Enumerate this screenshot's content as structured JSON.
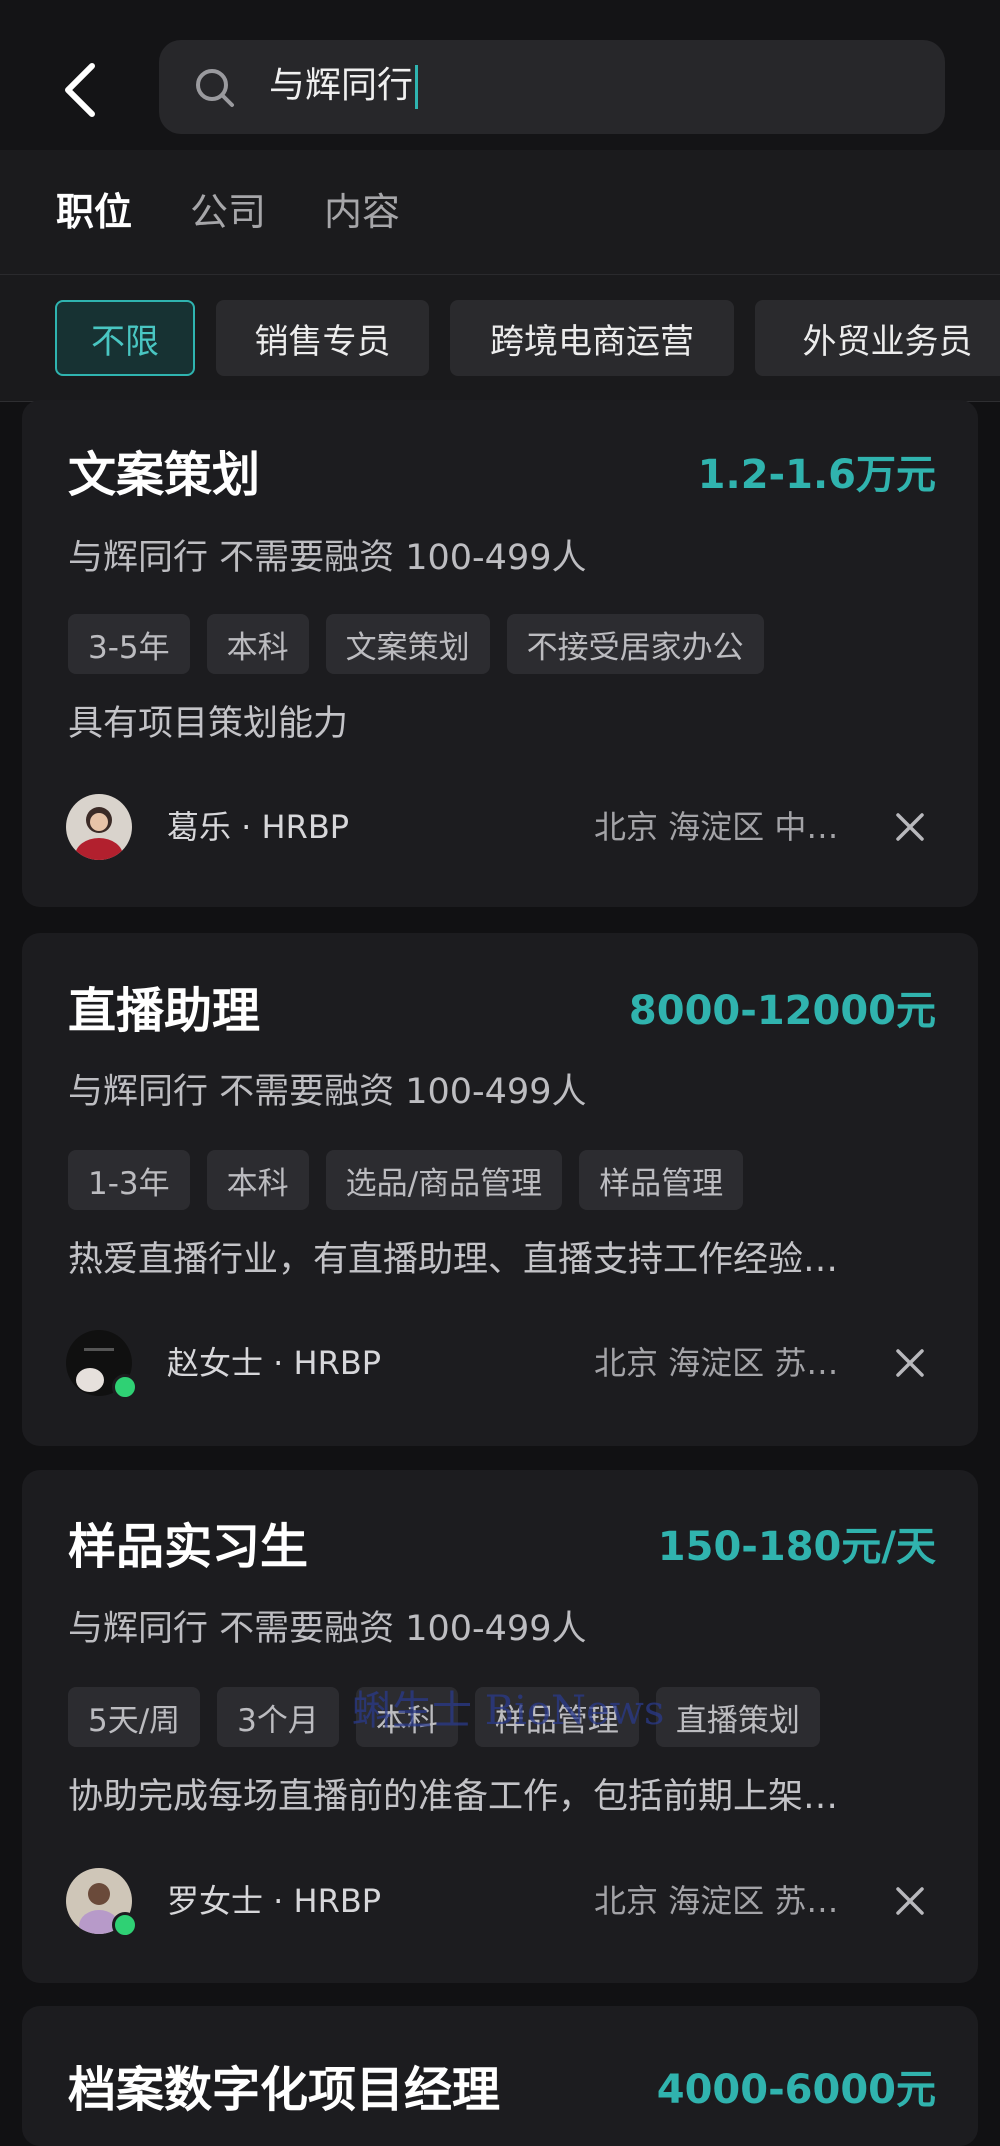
{
  "search": {
    "query": "与辉同行"
  },
  "tabs": [
    {
      "label": "职位",
      "active": true
    },
    {
      "label": "公司",
      "active": false
    },
    {
      "label": "内容",
      "active": false
    }
  ],
  "filters": [
    {
      "label": "不限",
      "active": true
    },
    {
      "label": "销售专员",
      "active": false
    },
    {
      "label": "跨境电商运营",
      "active": false
    },
    {
      "label": "外贸业务员",
      "active": false
    }
  ],
  "jobs": [
    {
      "title": "文案策划",
      "salary": "1.2-1.6万元",
      "company": "与辉同行  不需要融资  100-499人",
      "tags": [
        "3-5年",
        "本科",
        "文案策划",
        "不接受居家办公"
      ],
      "description": "具有项目策划能力",
      "recruiter": "葛乐 · HRBP",
      "location": "北京  海淀区  中…",
      "online": false
    },
    {
      "title": "直播助理",
      "salary": "8000-12000元",
      "company": "与辉同行  不需要融资  100-499人",
      "tags": [
        "1-3年",
        "本科",
        "选品/商品管理",
        "样品管理"
      ],
      "description": "热爱直播行业，有直播助理、直播支持工作经验…",
      "recruiter": "赵女士 · HRBP",
      "location": "北京  海淀区  苏…",
      "online": true
    },
    {
      "title": "样品实习生",
      "salary": "150-180元/天",
      "company": "与辉同行  不需要融资  100-499人",
      "tags": [
        "5天/周",
        "3个月",
        "本科",
        "样品管理",
        "直播策划"
      ],
      "description": "协助完成每场直播前的准备工作，包括前期上架…",
      "recruiter": "罗女士 · HRBP",
      "location": "北京  海淀区  苏…",
      "online": true
    },
    {
      "title": "档案数字化项目经理",
      "salary": "4000-6000元"
    }
  ],
  "watermark": "蝌生士 BioNews",
  "colors": {
    "accent": "#2fb4b0",
    "background": "#111113",
    "card": "#1c1c1f",
    "online": "#2fd174"
  },
  "icons": {
    "back": "chevron-left-icon",
    "search": "search-icon",
    "close": "close-icon"
  }
}
